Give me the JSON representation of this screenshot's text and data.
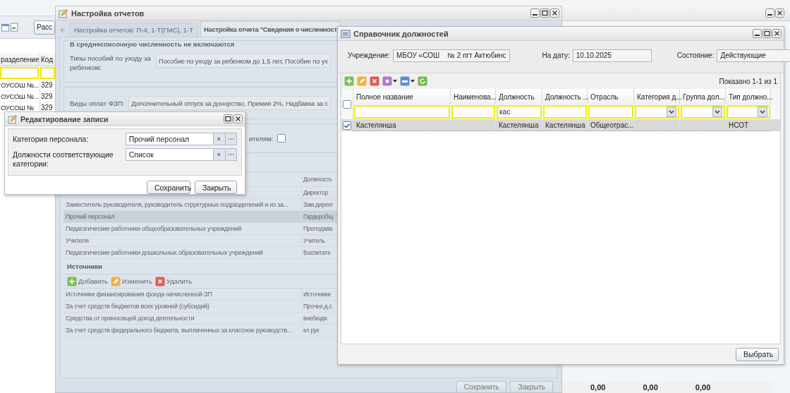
{
  "background": {
    "toolbar_button": "Расс",
    "columns": [
      "разделение",
      "Код"
    ],
    "rows": [
      [
        "ОУСОШ №...",
        "329"
      ],
      [
        "ОУСОШ №...",
        "329"
      ],
      [
        "ОУСОШ №",
        "329"
      ]
    ],
    "totals": [
      "0,00",
      "0,00",
      "0,00"
    ]
  },
  "report_window": {
    "title": "Настройка отчетов",
    "tabs": [
      {
        "label": "Настройка отчетов: П-4, 1-Т(ГМС), 1-Т",
        "selected": false
      },
      {
        "label": "Настройка отчета \"Сведения о численност",
        "selected": true
      }
    ],
    "excluded_section": {
      "title": "В среднесписочную численность не включаются",
      "label": "Типы пособий по уходу за ребенком:",
      "value": "Пособие по уходу за ребенком до 1,5 лет, Пособие по ух"
    },
    "payments_field": {
      "label": "Виды оплат ФЗП:",
      "value": "Дополнительный отпуск за донорство, Премия 2%, Надбавка за с"
    },
    "checkbox_field": {
      "label": "ителям:",
      "checked": false
    },
    "categories": {
      "column_2": "Должность",
      "rows": [
        {
          "position": "Директор",
          "selected": false
        },
        {
          "name": "Заместитель руководителя, руководитель структурных подразделений и из за...",
          "position": "Зам.директ",
          "selected": false
        },
        {
          "name": "Прочий персонал",
          "position": "Гардеробщ",
          "selected": true
        },
        {
          "name": "Педагогические работники общеобразовательных учреждений",
          "position": "Преподава",
          "selected": false
        },
        {
          "name": "Учителя",
          "position": "Учитель",
          "selected": false
        },
        {
          "name": "Педагогические работники дошкольных образовательных учреждений",
          "position": "Воспитате",
          "selected": false
        }
      ]
    },
    "sources": {
      "title": "Источники",
      "toolbar": [
        {
          "kind": "add",
          "label": "Добавить"
        },
        {
          "kind": "edit",
          "label": "Изменить"
        },
        {
          "kind": "delete",
          "label": "Удалить"
        }
      ],
      "rows": [
        {
          "name": "Источники финансирования фонда начисленной ЗП",
          "code": "Источники"
        },
        {
          "name": "За счет средств бюджетов всех уровней (субсидий)",
          "code": "Прочее,д.с"
        },
        {
          "name": "Средства от приносящей доход деятельности",
          "code": "внебюдж"
        },
        {
          "name": "За счет средств федерального бюджета, выплаченных за классное руководств...",
          "code": "кл рук"
        }
      ]
    },
    "buttons": [
      "Сохранить",
      "Закрыть"
    ]
  },
  "edit_dialog": {
    "title": "Редактирование записи",
    "fields": [
      {
        "label": "Категория персонала:",
        "value": "Прочий персонал"
      },
      {
        "label": "Должности соответствующие категории:",
        "value": "Список"
      }
    ],
    "buttons": [
      "Сохранить",
      "Закрыть"
    ]
  },
  "positions_window": {
    "title": "Справочник должностей",
    "filters": [
      {
        "label": "Учреждение:",
        "value": "МБОУ «СОШ    № 2 пгт Актюбинс"
      },
      {
        "label": "На дату:",
        "value": "10.10.2025"
      },
      {
        "label": "Состояние:",
        "value": "Действующие"
      }
    ],
    "paging": "Показано 1-1 из 1",
    "header_checked": false,
    "columns": [
      {
        "label": "Полное название",
        "kind": "text"
      },
      {
        "label": "Наименова...",
        "kind": "text"
      },
      {
        "label": "Должность",
        "kind": "text",
        "filter": "кас"
      },
      {
        "label": "Должность ...",
        "kind": "text"
      },
      {
        "label": "Отрасль",
        "kind": "text"
      },
      {
        "label": "Категория д...",
        "kind": "combo"
      },
      {
        "label": "Группа дол...",
        "kind": "combo"
      },
      {
        "label": "Тип должно...",
        "kind": "combo"
      }
    ],
    "rows": [
      {
        "checked": true,
        "selected": true,
        "cells": [
          "Кастелянша",
          null,
          "Кастелянша",
          "Кастелянша",
          "Общеотрас...",
          null,
          null,
          "НСОТ"
        ]
      }
    ],
    "buttons": [
      "Выбрать"
    ]
  }
}
